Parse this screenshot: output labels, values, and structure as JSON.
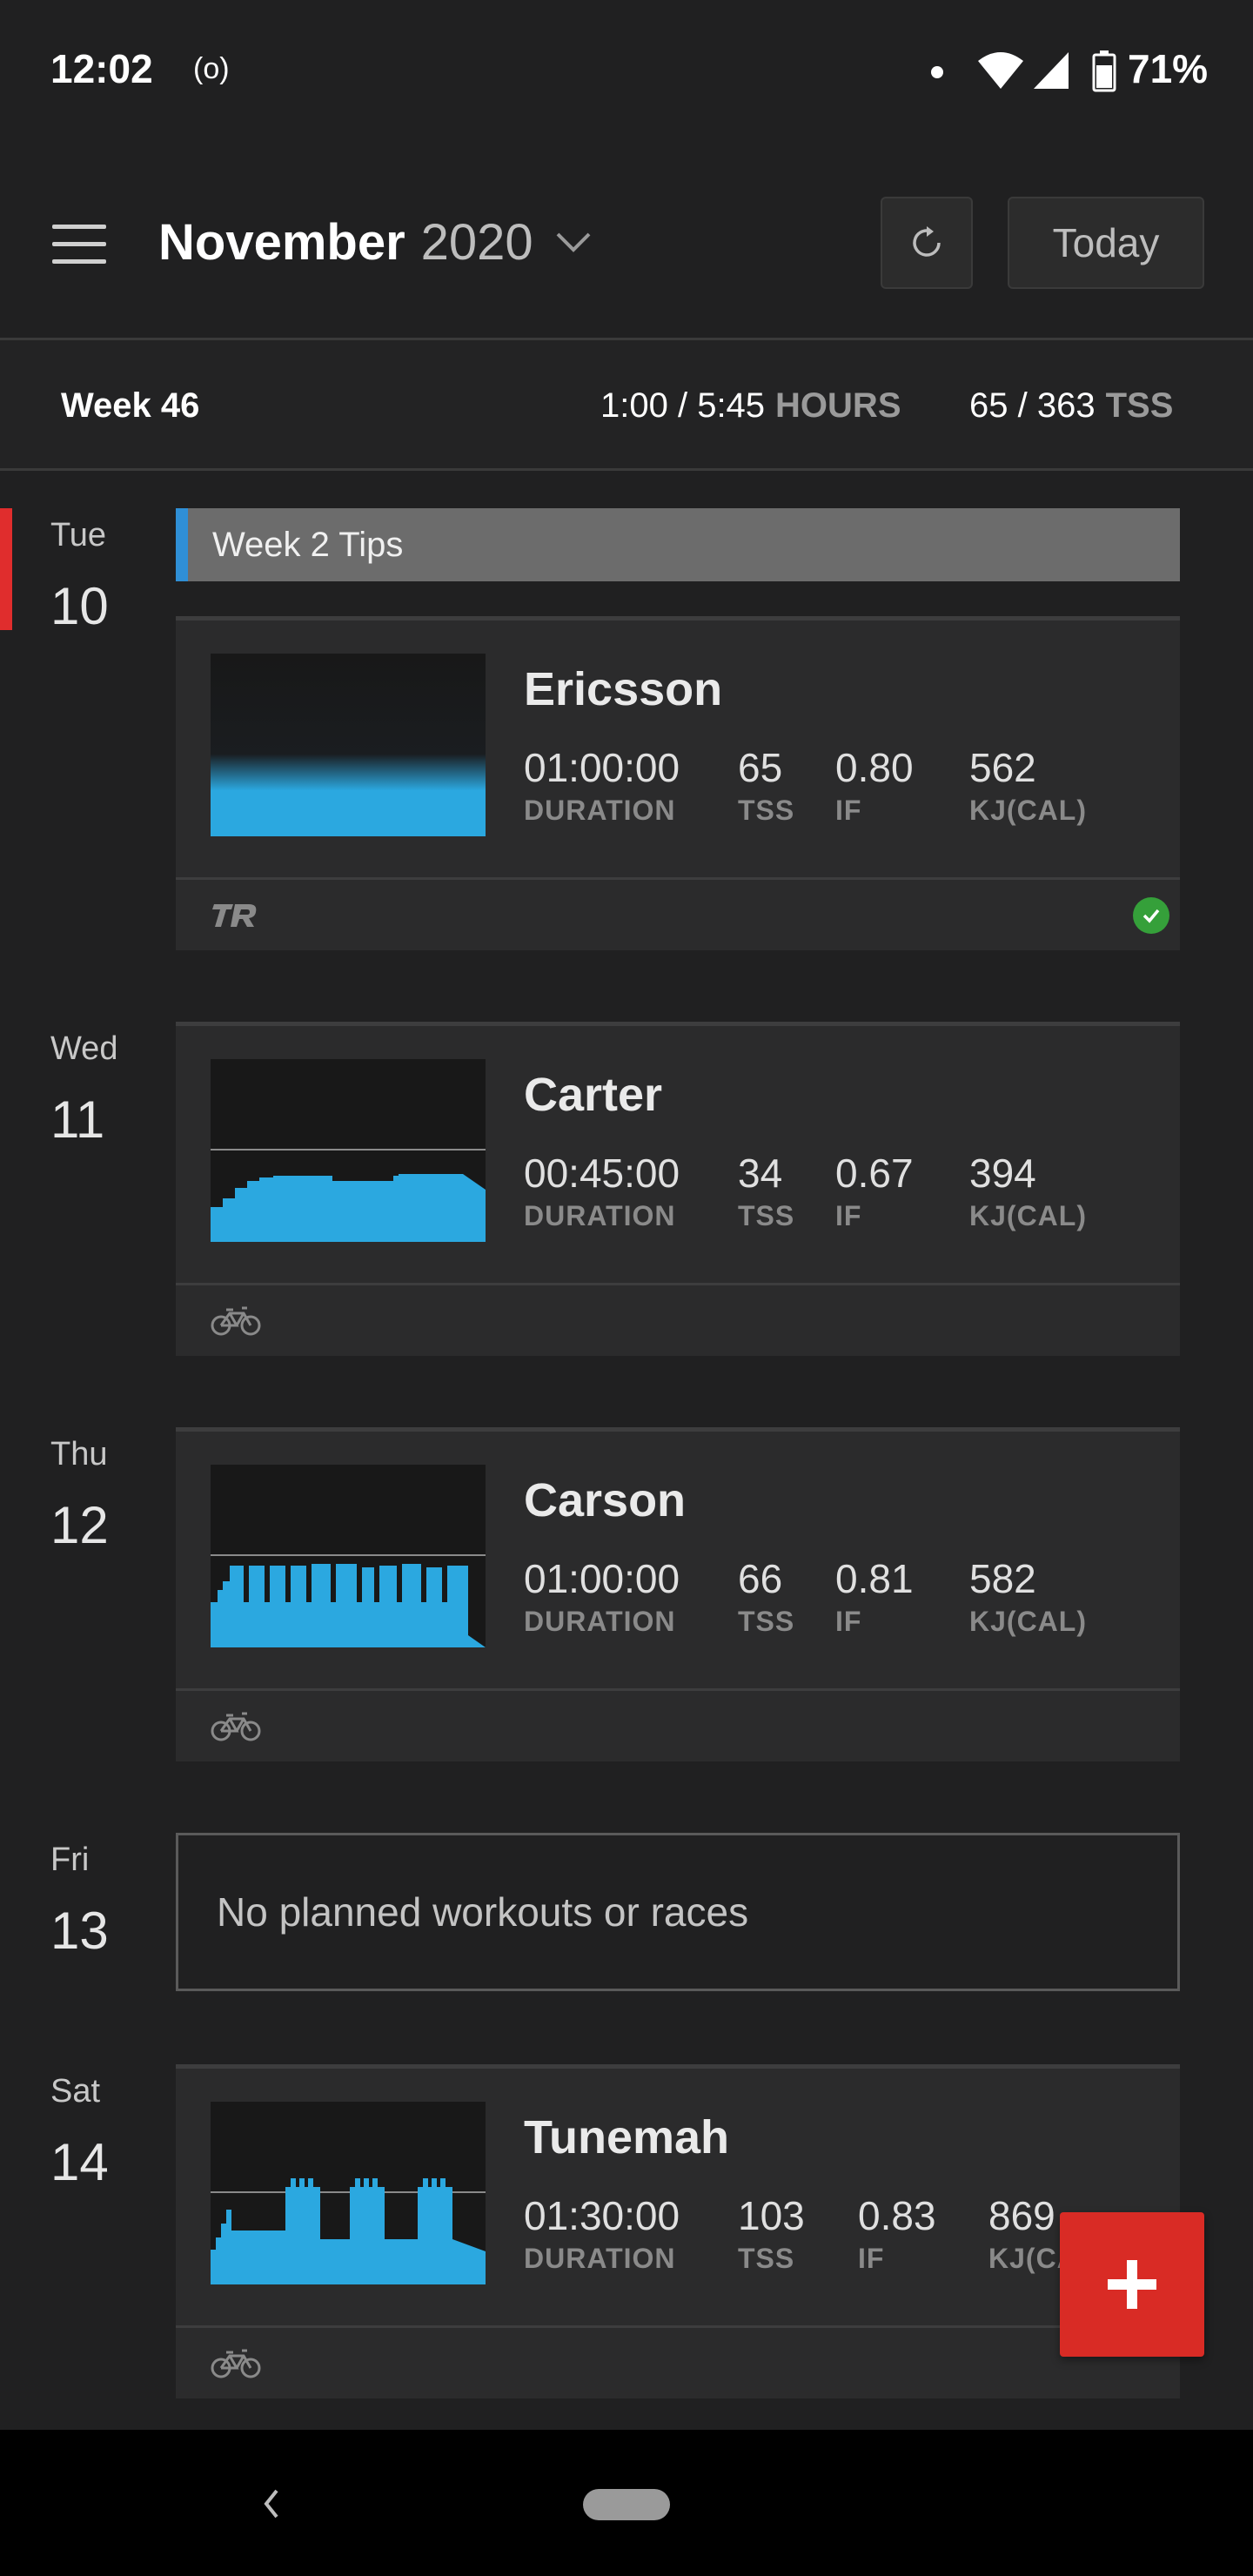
{
  "status_bar": {
    "time": "12:02",
    "sync_icon": "(o)",
    "battery": "71%"
  },
  "toolbar": {
    "month": "November",
    "year": "2020",
    "today_label": "Today"
  },
  "week": {
    "label": "Week 46",
    "hours_value": "1:00 / 5:45",
    "hours_unit": "HOURS",
    "tss_value": "65 / 363",
    "tss_unit": "TSS"
  },
  "days": [
    {
      "dow": "Tue",
      "num": "10"
    },
    {
      "dow": "Wed",
      "num": "11"
    },
    {
      "dow": "Thu",
      "num": "12"
    },
    {
      "dow": "Fri",
      "num": "13"
    },
    {
      "dow": "Sat",
      "num": "14"
    }
  ],
  "note": {
    "label": "Week 2 Tips",
    "accent": "#2f8fd6"
  },
  "metric_labels": {
    "duration": "DURATION",
    "tss": "TSS",
    "if": "IF",
    "kj": "KJ(CAL)"
  },
  "workouts": [
    {
      "title": "Ericsson",
      "duration": "01:00:00",
      "tss": "65",
      "if": "0.80",
      "kj": "562",
      "footer_icon": "trainerroad-logo-icon",
      "completed": true
    },
    {
      "title": "Carter",
      "duration": "00:45:00",
      "tss": "34",
      "if": "0.67",
      "kj": "394",
      "footer_icon": "bike-icon"
    },
    {
      "title": "Carson",
      "duration": "01:00:00",
      "tss": "66",
      "if": "0.81",
      "kj": "582",
      "footer_icon": "bike-icon"
    },
    {
      "title": "Tunemah",
      "duration": "01:30:00",
      "tss": "103",
      "if": "0.83",
      "kj": "869",
      "footer_icon": "bike-icon"
    }
  ],
  "empty_day_text": "No planned workouts or races",
  "colors": {
    "background": "#202021",
    "card": "#2b2b2c",
    "graph_fill": "#2ba8e0",
    "today_marker": "#e02d2d",
    "fab": "#d92b25",
    "completed_check": "#35a03a"
  }
}
